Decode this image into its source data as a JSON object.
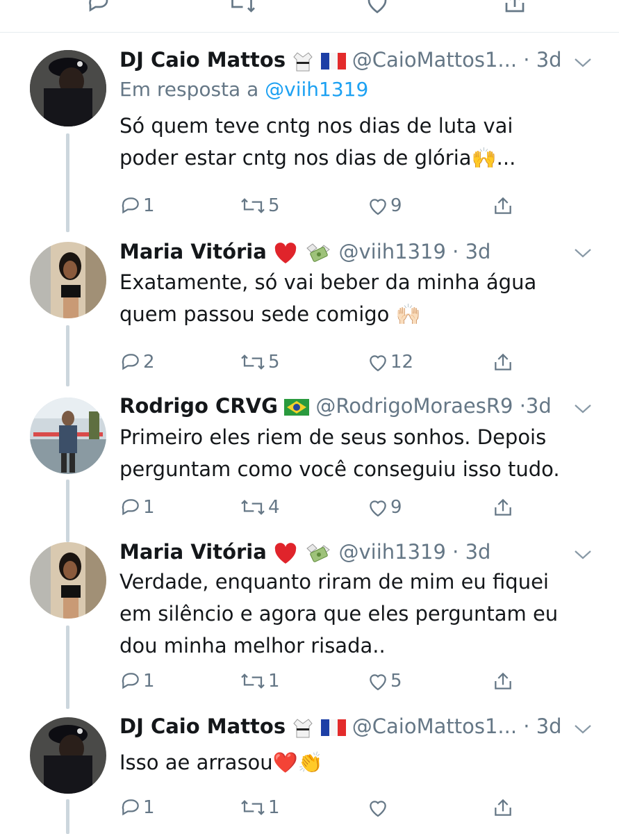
{
  "tweets": [
    {
      "name": "DJ Caio Mattos",
      "handle": "@CaioMattos1...",
      "time": "3d",
      "reply_prefix": "Em resposta a ",
      "reply_mention": "@viih1319",
      "text": "Só quem teve cntg nos dias de luta vai\npoder estar cntg nos dias de glória🙌...",
      "replies": "1",
      "retweets": "5",
      "likes": "9"
    },
    {
      "name": "Maria Vitória",
      "handle": "@viih1319",
      "time": "3d",
      "text": "Exatamente, só vai beber da minha água\nquem passou sede comigo 🙌🏻",
      "replies": "2",
      "retweets": "5",
      "likes": "12"
    },
    {
      "name": "Rodrigo CRVG",
      "handle": "@RodrigoMoraesR9",
      "time": "3d",
      "text": "Primeiro eles riem de seus sonhos.  Depois\nperguntam como você conseguiu isso tudo.",
      "replies": "1",
      "retweets": "4",
      "likes": "9"
    },
    {
      "name": "Maria Vitória",
      "handle": "@viih1319",
      "time": "3d",
      "text": "Verdade, enquanto riram de mim eu fiquei\nem silêncio e agora que eles perguntam eu\ndou minha melhor risada..",
      "replies": "1",
      "retweets": "1",
      "likes": "5"
    },
    {
      "name": "DJ Caio Mattos",
      "handle": "@CaioMattos1...",
      "time": "3d",
      "text": "Isso ae arrasou❤️👏",
      "replies": "1",
      "retweets": "1",
      "likes": ""
    }
  ],
  "colors": {
    "secondary": "#657786",
    "link": "#1da1f2",
    "thread_line": "#ccd6dd"
  }
}
